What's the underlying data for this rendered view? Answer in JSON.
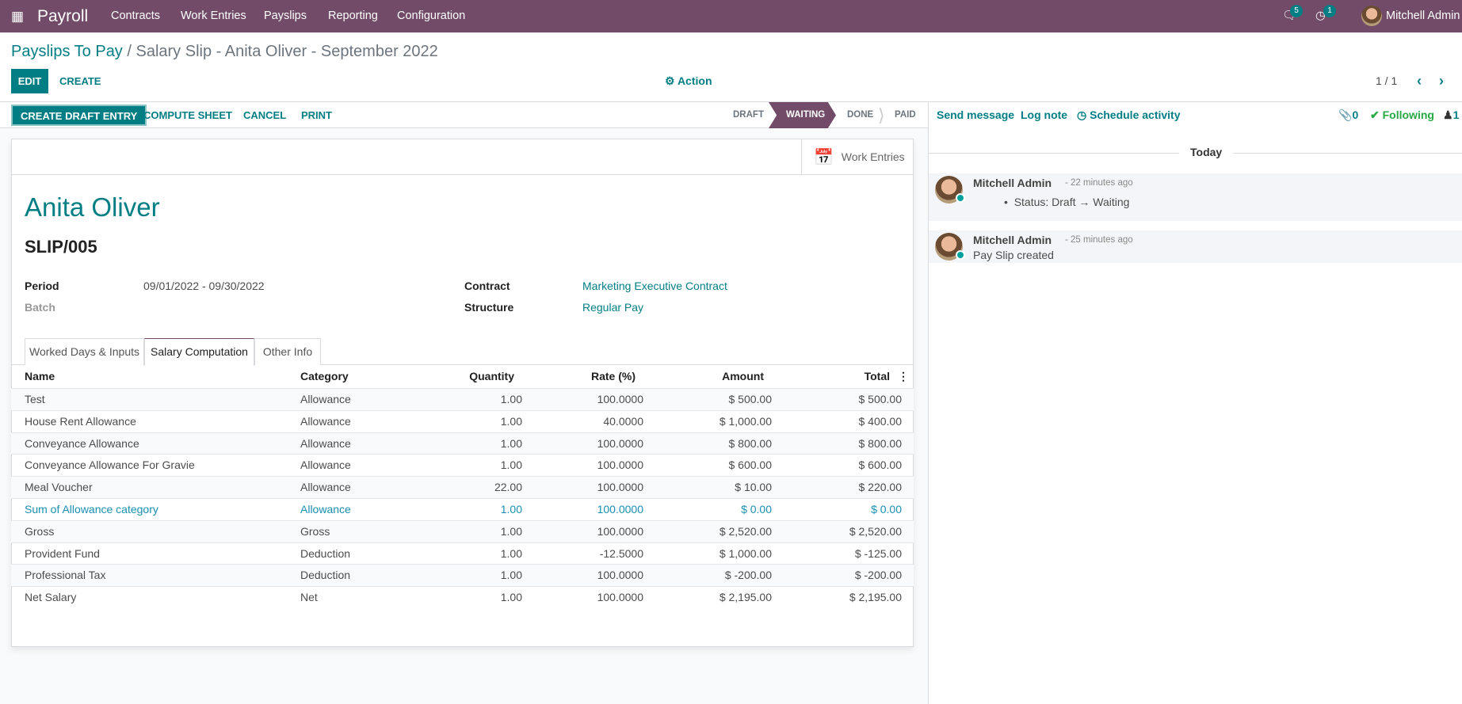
{
  "navbar": {
    "app": "Payroll",
    "menu": [
      "Contracts",
      "Work Entries",
      "Payslips",
      "Reporting",
      "Configuration"
    ],
    "messages_count": "5",
    "activities_count": "1",
    "user": "Mitchell Admin"
  },
  "breadcrumb": {
    "parent": "Payslips To Pay",
    "current": "/ Salary Slip - Anita Oliver - September 2022"
  },
  "toolbar": {
    "edit": "EDIT",
    "create": "CREATE",
    "action": "Action",
    "pager": "1 / 1"
  },
  "header_buttons": {
    "create_draft": "CREATE DRAFT ENTRY",
    "compute": "COMPUTE SHEET",
    "cancel": "CANCEL",
    "print": "PRINT"
  },
  "statusbar": {
    "stages": [
      "DRAFT",
      "WAITING",
      "DONE",
      "PAID"
    ],
    "active": "WAITING"
  },
  "sheet": {
    "work_entries": "Work Entries",
    "employee": "Anita Oliver",
    "reference": "SLIP/005",
    "fields": {
      "period_label": "Period",
      "period": "09/01/2022 - 09/30/2022",
      "batch_label": "Batch",
      "contract_label": "Contract",
      "contract": "Marketing Executive Contract",
      "structure_label": "Structure",
      "structure": "Regular Pay"
    },
    "tabs": [
      "Worked Days & Inputs",
      "Salary Computation",
      "Other Info"
    ],
    "active_tab": "Salary Computation"
  },
  "table": {
    "headers": [
      "Name",
      "Category",
      "Quantity",
      "Rate (%)",
      "Amount",
      "Total"
    ],
    "rows": [
      [
        "Test",
        "Allowance",
        "1.00",
        "100.0000",
        "$ 500.00",
        "$ 500.00"
      ],
      [
        "House Rent Allowance",
        "Allowance",
        "1.00",
        "40.0000",
        "$ 1,000.00",
        "$ 400.00"
      ],
      [
        "Conveyance Allowance",
        "Allowance",
        "1.00",
        "100.0000",
        "$ 800.00",
        "$ 800.00"
      ],
      [
        "Conveyance Allowance For Gravie",
        "Allowance",
        "1.00",
        "100.0000",
        "$ 600.00",
        "$ 600.00"
      ],
      [
        "Meal Voucher",
        "Allowance",
        "22.00",
        "100.0000",
        "$ 10.00",
        "$ 220.00"
      ],
      [
        "Sum of Allowance category",
        "Allowance",
        "1.00",
        "100.0000",
        "$ 0.00",
        "$ 0.00"
      ],
      [
        "Gross",
        "Gross",
        "1.00",
        "100.0000",
        "$ 2,520.00",
        "$ 2,520.00"
      ],
      [
        "Provident Fund",
        "Deduction",
        "1.00",
        "-12.5000",
        "$ 1,000.00",
        "$ -125.00"
      ],
      [
        "Professional Tax",
        "Deduction",
        "1.00",
        "100.0000",
        "$ -200.00",
        "$ -200.00"
      ],
      [
        "Net Salary",
        "Net",
        "1.00",
        "100.0000",
        "$ 2,195.00",
        "$ 2,195.00"
      ]
    ],
    "highlight_row": 5,
    "highlight_color": "#1a8fb0"
  },
  "chatter": {
    "send": "Send message",
    "log": "Log note",
    "schedule": "Schedule activity",
    "attachments": "0",
    "following": "Following",
    "followers": "1",
    "today": "Today",
    "messages": [
      {
        "author": "Mitchell Admin",
        "time": "- 22 minutes ago",
        "body": "Status: Draft → Waiting"
      },
      {
        "author": "Mitchell Admin",
        "time": "- 25 minutes ago",
        "body": "Pay Slip created"
      }
    ]
  },
  "colors": {
    "brand": "#714b67",
    "accent": "#017e84"
  }
}
